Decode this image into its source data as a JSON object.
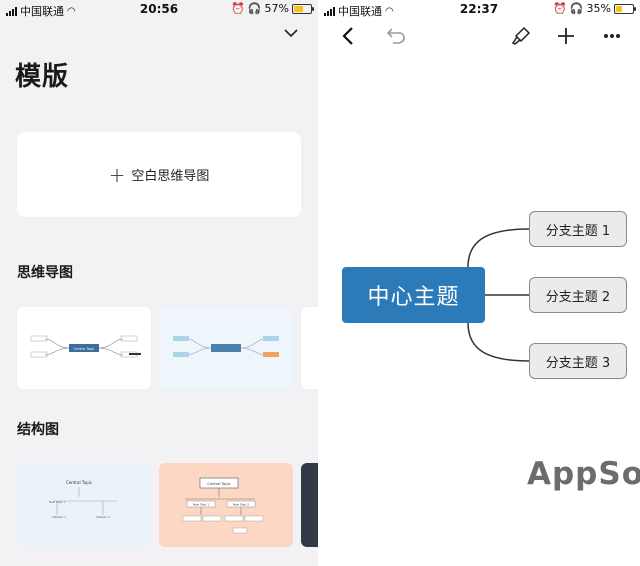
{
  "left_screen": {
    "status_bar": {
      "carrier": "中国联通",
      "time": "20:56",
      "battery": "57%",
      "battery_level": 0.57
    },
    "title": "模版",
    "blank_template": {
      "plus": "+",
      "label": "空白思维导图"
    },
    "sections": [
      {
        "title": "思维导图"
      },
      {
        "title": "结构图"
      }
    ],
    "thumb_labels": {
      "central_topic": "Central Topic",
      "main_topic_1": "Main Topic 1",
      "main_topic_2": "Main Topic 2",
      "subtopic_1": "Subtopic 1",
      "subtopic_2": "Subtopic 2"
    }
  },
  "right_screen": {
    "status_bar": {
      "carrier": "中国联通",
      "time": "22:37",
      "battery": "35%",
      "battery_level": 0.35
    },
    "central_topic": "中心主题",
    "branches": [
      "分支主题 1",
      "分支主题 2",
      "分支主题 3"
    ],
    "watermark": "AppSo",
    "colors": {
      "central": "#2d7ab8",
      "branch_bg": "#ebebeb",
      "branch_border": "#8a8a8a",
      "line": "#333333"
    }
  }
}
